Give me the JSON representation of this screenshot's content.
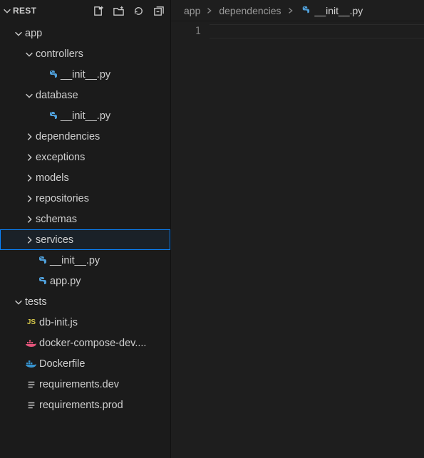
{
  "explorer": {
    "title": "REST",
    "actions": {
      "new_file": "New File",
      "new_folder": "New Folder",
      "refresh": "Refresh",
      "collapse": "Collapse All"
    }
  },
  "tree": [
    {
      "kind": "folder",
      "expanded": true,
      "depth": 0,
      "label": "app"
    },
    {
      "kind": "folder",
      "expanded": true,
      "depth": 1,
      "label": "controllers"
    },
    {
      "kind": "file",
      "depth": 2,
      "label": "__init__.py",
      "icon": "python"
    },
    {
      "kind": "folder",
      "expanded": true,
      "depth": 1,
      "label": "database"
    },
    {
      "kind": "file",
      "depth": 2,
      "label": "__init__.py",
      "icon": "python"
    },
    {
      "kind": "folder",
      "expanded": false,
      "depth": 1,
      "label": "dependencies"
    },
    {
      "kind": "folder",
      "expanded": false,
      "depth": 1,
      "label": "exceptions"
    },
    {
      "kind": "folder",
      "expanded": false,
      "depth": 1,
      "label": "models"
    },
    {
      "kind": "folder",
      "expanded": false,
      "depth": 1,
      "label": "repositories"
    },
    {
      "kind": "folder",
      "expanded": false,
      "depth": 1,
      "label": "schemas"
    },
    {
      "kind": "folder",
      "expanded": false,
      "depth": 1,
      "label": "services",
      "selected": true
    },
    {
      "kind": "file",
      "depth": 1,
      "label": "__init__.py",
      "icon": "python"
    },
    {
      "kind": "file",
      "depth": 1,
      "label": "app.py",
      "icon": "python"
    },
    {
      "kind": "folder",
      "expanded": true,
      "depth": 0,
      "label": "tests"
    },
    {
      "kind": "file",
      "depth": 0,
      "label": "db-init.js",
      "icon": "js"
    },
    {
      "kind": "file",
      "depth": 0,
      "label": "docker-compose-dev....",
      "icon": "compose"
    },
    {
      "kind": "file",
      "depth": 0,
      "label": "Dockerfile",
      "icon": "docker"
    },
    {
      "kind": "file",
      "depth": 0,
      "label": "requirements.dev",
      "icon": "lines"
    },
    {
      "kind": "file",
      "depth": 0,
      "label": "requirements.prod",
      "icon": "lines"
    }
  ],
  "breadcrumb": {
    "part1": "app",
    "part2": "dependencies",
    "file": "__init__.py"
  },
  "editor": {
    "line_numbers": [
      "1"
    ]
  }
}
